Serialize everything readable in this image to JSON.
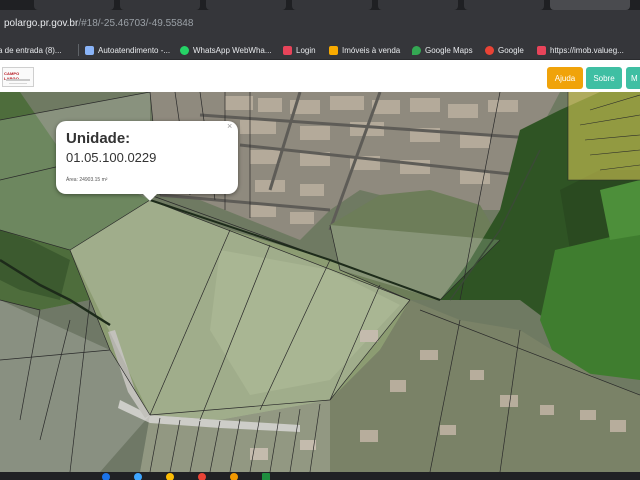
{
  "browser": {
    "address": {
      "host_prefix": "",
      "host": "polargo.pr.gov.br",
      "path": "/#18/-25.46703/-49.55848"
    },
    "bookmarks": [
      {
        "label": "a de entrada (8)...",
        "color": "#8ab4f8"
      },
      {
        "label": "Autoatendimento -...",
        "color": "#fbbc04"
      },
      {
        "label": "WhatsApp WebWha...",
        "color": "#25d366"
      },
      {
        "label": "Login",
        "color": "#e8445a"
      },
      {
        "label": "Imóveis à venda",
        "color": "#f9ab00"
      },
      {
        "label": "Google Maps",
        "color": "#34a853"
      },
      {
        "label": "Google",
        "color": "#ea4335"
      },
      {
        "label": "https://imob.valueg...",
        "color": "#e8445a"
      }
    ]
  },
  "app": {
    "logo_text": "CAMPO LARGO",
    "buttons": [
      {
        "label": "Ajuda",
        "color": "#f0a30a"
      },
      {
        "label": "Sobre",
        "color": "#3fbfa3"
      },
      {
        "label": "M",
        "color": "#3fbfa3"
      }
    ]
  },
  "popup": {
    "title": "Unidade:",
    "code": "01.05.100.0229",
    "area": "Área: 24903.15 m²",
    "close": "×"
  },
  "colors": {
    "parcel_line": "#2a2a2a",
    "vegetation": "#3f6a2f",
    "field": "#8fa078",
    "highlight": "#e4d35a"
  }
}
